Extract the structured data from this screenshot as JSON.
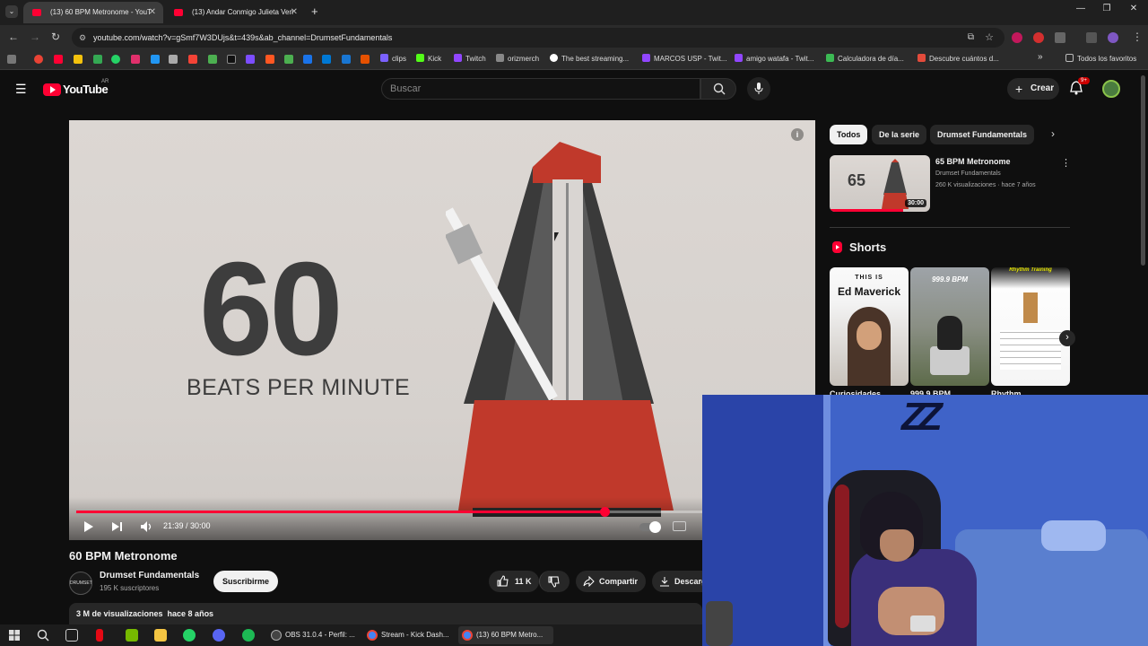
{
  "browser": {
    "tabs": [
      {
        "title": "(13) 60 BPM Metronome - YouT",
        "active": true
      },
      {
        "title": "(13) Andar Conmigo Julieta Ven",
        "active": false
      }
    ],
    "new_tab": "+",
    "url": "youtube.com/watch?v=gSmf7W3DUjs&t=439s&ab_channel=DrumsetFundamentals",
    "bookmarks": [
      {
        "label": "clips",
        "color": "#7b61ff"
      },
      {
        "label": "Kick",
        "color": "#53fc18"
      },
      {
        "label": "Twitch",
        "color": "#9146ff"
      },
      {
        "label": "orizmerch",
        "color": "#888888"
      },
      {
        "label": "The best streaming...",
        "color": "#ffffff"
      },
      {
        "label": "MARCOS USP - Twit...",
        "color": "#9146ff"
      },
      {
        "label": "amigo watafa - Twit...",
        "color": "#9146ff"
      },
      {
        "label": "Calculadora de día...",
        "color": "#3cba54"
      },
      {
        "label": "Descubre cuántos d...",
        "color": "#e34b3b"
      }
    ],
    "all_bookmarks": "Todos los favoritos"
  },
  "youtube": {
    "logo": "YouTube",
    "region": "AR",
    "search_placeholder": "Buscar",
    "create_label": "Crear",
    "notif_badge": "9+"
  },
  "player": {
    "big_number": "60",
    "caption": "BEATS PER MINUTE",
    "time": "21:39 / 30:00",
    "progress_fraction": 0.7217
  },
  "video": {
    "title": "60 BPM Metronome",
    "channel": "Drumset Fundamentals",
    "channel_icon_text": "DRUMSET",
    "subscribers": "195 K suscriptores",
    "subscribe_label": "Suscribirme",
    "likes": "11 K",
    "share_label": "Compartir",
    "download_label": "Descarg",
    "views_line": "3 M de visualizaciones  hace 8 años"
  },
  "sidebar": {
    "chips": [
      "Todos",
      "De la serie",
      "Drumset Fundamentals"
    ],
    "recommended": {
      "thumb_number": "65",
      "duration": "30:00",
      "title": "65 BPM Metronome",
      "channel": "Drumset Fundamentals",
      "meta": "260 K visualizaciones · hace 7 años"
    },
    "shorts_title": "Shorts",
    "shorts": [
      {
        "overlay_top": "THIS IS",
        "overlay_main": "Ed Maverick",
        "caption": "Curiosidades"
      },
      {
        "overlay_top": "999.9 BPM",
        "overlay_main": "",
        "caption": "999.9 BPM"
      },
      {
        "overlay_top": "Rhythm Training",
        "overlay_main": "",
        "caption": "Rhythm"
      }
    ]
  },
  "webcam": {
    "wall_graffiti": "ZZ"
  },
  "taskbar": {
    "apps": [
      {
        "label": "OBS 31.0.4 - Perfil: ...",
        "color": "#444444"
      },
      {
        "label": "Stream - Kick Dash...",
        "color": "#4285f4"
      },
      {
        "label": "(13) 60 BPM Metro...",
        "color": "#4285f4"
      }
    ]
  }
}
